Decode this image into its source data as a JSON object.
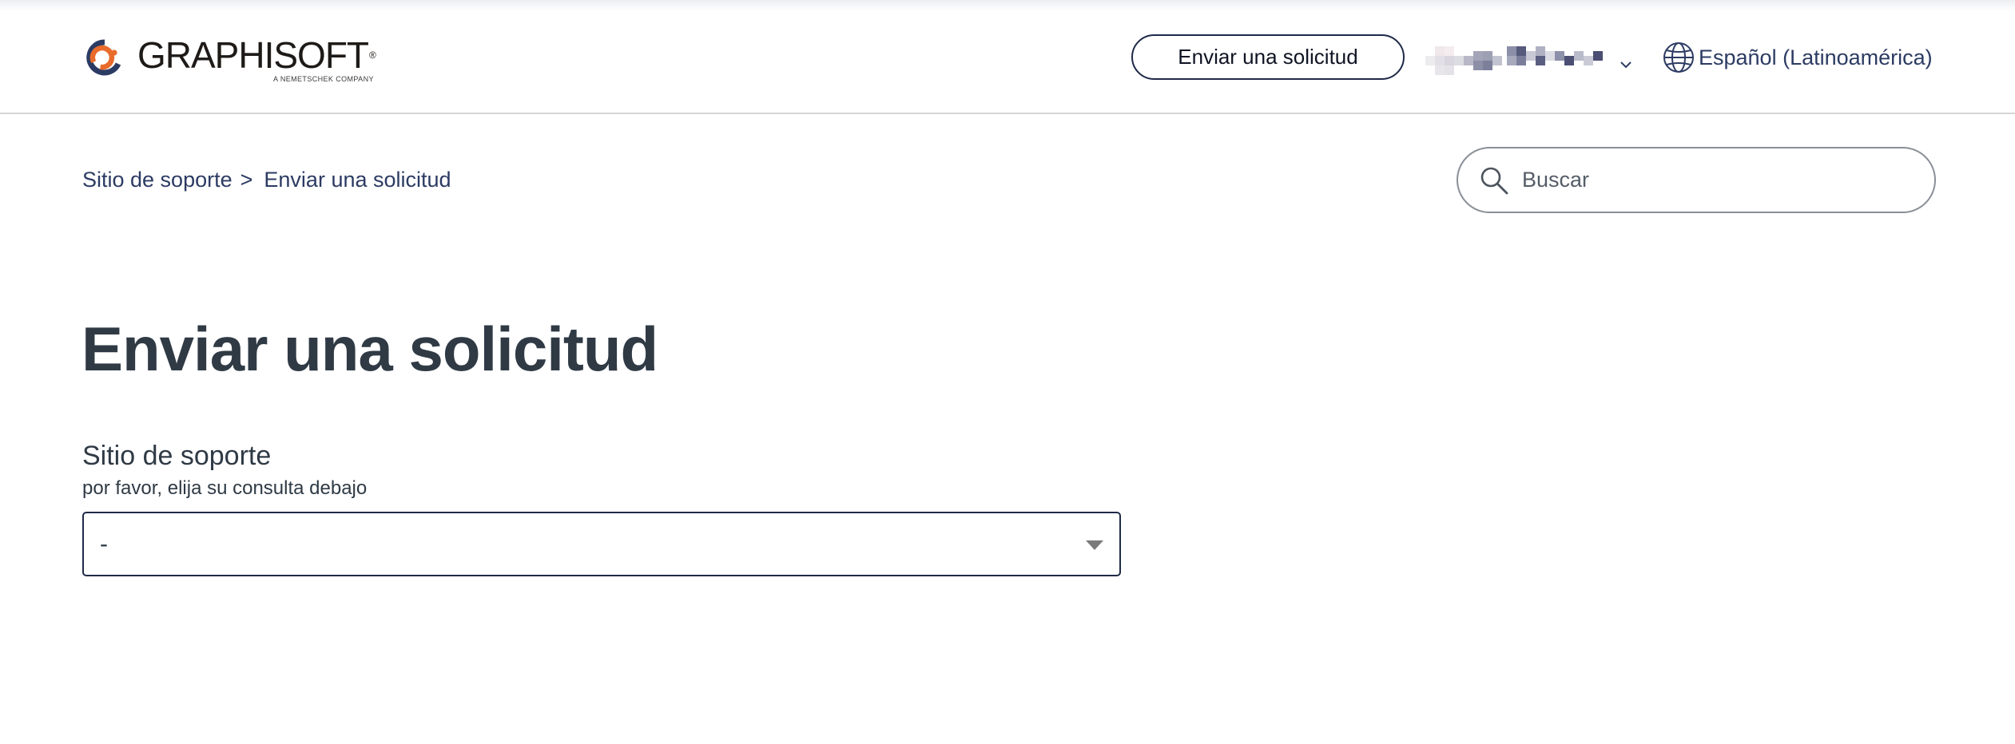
{
  "header": {
    "logo": {
      "wordmark": "GRAPHISOFT",
      "registered": "®",
      "tagline": "A NEMETSCHEK COMPANY",
      "brand_orange": "#e96b2b",
      "brand_navy": "#2c3b63"
    },
    "submit_request_label": "Enviar una solicitud",
    "user_menu_icon": "chevron-down-icon",
    "language": {
      "icon": "globe-icon",
      "label": "Español (Latinoamérica)"
    }
  },
  "breadcrumb": {
    "items": [
      {
        "label": "Sitio de soporte"
      },
      {
        "label": "Enviar una solicitud"
      }
    ],
    "separator": ">"
  },
  "search": {
    "placeholder": "Buscar",
    "value": ""
  },
  "main": {
    "title": "Enviar una solicitud",
    "form": {
      "field_label": "Sitio de soporte",
      "field_hint": "por favor, elija su consulta debajo",
      "selected_value": "-"
    }
  },
  "colors": {
    "text_dark": "#2f3a45",
    "link_navy": "#2c3b63",
    "border_navy": "#1f2a48",
    "divider": "#d6d6d6"
  }
}
